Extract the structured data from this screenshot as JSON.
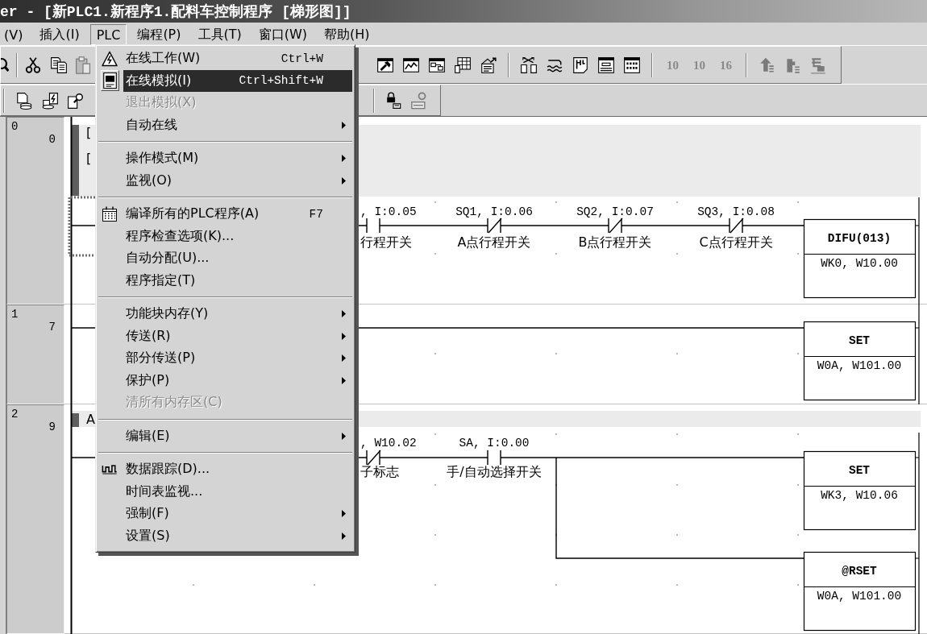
{
  "window": {
    "title": "er - [新PLC1.新程序1.配料车控制程序 [梯形图]]"
  },
  "menu_bar": [
    {
      "label": "(V)",
      "selected": false
    },
    {
      "label": "插入(I)",
      "selected": false
    },
    {
      "label": "PLC",
      "selected": true
    },
    {
      "label": "编程(P)",
      "selected": false
    },
    {
      "label": "工具(T)",
      "selected": false
    },
    {
      "label": "窗口(W)",
      "selected": false
    },
    {
      "label": "帮助(H)",
      "selected": false
    }
  ],
  "toolbars": [
    {
      "segments": [
        [
          {
            "kind": "button",
            "disabled": false
          },
          {
            "kind": "separator"
          },
          {
            "kind": "button",
            "disabled": false
          },
          {
            "kind": "button",
            "disabled": false
          },
          {
            "kind": "button",
            "disabled": true
          }
        ],
        [
          {
            "kind": "button",
            "disabled": false
          },
          {
            "kind": "button",
            "disabled": false
          },
          {
            "kind": "button",
            "disabled": false
          },
          {
            "kind": "button",
            "disabled": false
          },
          {
            "kind": "button",
            "disabled": false
          },
          {
            "kind": "separator"
          },
          {
            "kind": "button",
            "disabled": false
          },
          {
            "kind": "button",
            "disabled": false
          },
          {
            "kind": "button",
            "disabled": false
          },
          {
            "kind": "button",
            "disabled": false
          },
          {
            "kind": "button",
            "disabled": false
          },
          {
            "kind": "separator"
          },
          {
            "kind": "text",
            "label": "10",
            "disabled": true
          },
          {
            "kind": "text",
            "label": "10",
            "disabled": true
          },
          {
            "kind": "text",
            "label": "16",
            "disabled": true
          },
          {
            "kind": "separator"
          },
          {
            "kind": "button",
            "disabled": true
          },
          {
            "kind": "button",
            "disabled": true
          },
          {
            "kind": "button",
            "disabled": true
          }
        ]
      ]
    },
    {
      "segments": [
        [
          {
            "kind": "separator"
          },
          {
            "kind": "button",
            "disabled": false
          },
          {
            "kind": "button",
            "disabled": false
          },
          {
            "kind": "button",
            "disabled": false
          }
        ],
        [
          {
            "kind": "separator"
          },
          {
            "kind": "button",
            "disabled": false
          },
          {
            "kind": "button",
            "disabled": true
          }
        ]
      ]
    }
  ],
  "plc_menu": {
    "groups": [
      [
        {
          "label": "在线工作(W)",
          "shortcut": "Ctrl+W",
          "selected": false,
          "disabled": false,
          "submenu": false
        },
        {
          "label": "在线模拟(I)",
          "shortcut": "Ctrl+Shift+W",
          "selected": true,
          "disabled": false,
          "submenu": false
        },
        {
          "label": "退出模拟(X)",
          "selected": false,
          "disabled": true,
          "submenu": false
        },
        {
          "label": "自动在线",
          "selected": false,
          "disabled": false,
          "submenu": true
        }
      ],
      [
        {
          "label": "操作模式(M)",
          "selected": false,
          "disabled": false,
          "submenu": true
        },
        {
          "label": "监视(O)",
          "selected": false,
          "disabled": false,
          "submenu": true
        }
      ],
      [
        {
          "label": "编译所有的PLC程序(A)",
          "shortcut": "F7",
          "selected": false,
          "disabled": false,
          "submenu": false
        },
        {
          "label": "程序检查选项(K)...",
          "selected": false,
          "disabled": false,
          "submenu": false
        },
        {
          "label": "自动分配(U)...",
          "selected": false,
          "disabled": false,
          "submenu": false
        },
        {
          "label": "程序指定(T)",
          "selected": false,
          "disabled": false,
          "submenu": false
        }
      ],
      [
        {
          "label": "功能块内存(Y)",
          "selected": false,
          "disabled": false,
          "submenu": true
        },
        {
          "label": "传送(R)",
          "selected": false,
          "disabled": false,
          "submenu": true
        },
        {
          "label": "部分传送(P)",
          "selected": false,
          "disabled": false,
          "submenu": true
        },
        {
          "label": "保护(P)",
          "selected": false,
          "disabled": false,
          "submenu": true
        },
        {
          "label": "清所有内存区(C)",
          "selected": false,
          "disabled": true,
          "submenu": false
        }
      ],
      [
        {
          "label": "编辑(E)",
          "selected": false,
          "disabled": false,
          "submenu": true
        }
      ],
      [
        {
          "label": "数据跟踪(D)...",
          "selected": false,
          "disabled": false,
          "submenu": false
        },
        {
          "label": "时间表监视...",
          "selected": false,
          "disabled": false,
          "submenu": false
        },
        {
          "label": "强制(F)",
          "selected": false,
          "disabled": false,
          "submenu": true
        },
        {
          "label": "设置(S)",
          "selected": false,
          "disabled": false,
          "submenu": true
        }
      ]
    ]
  },
  "rungs": [
    {
      "number": "0",
      "step": "0",
      "cursor": true,
      "comment_lines": [
        "[",
        "["
      ],
      "contacts": [
        {
          "kind": "no",
          "operand": ", I:0.05",
          "comment": "行程开关"
        },
        {
          "kind": "nc",
          "operand": "SQ1, I:0.06",
          "comment": "A点行程开关"
        },
        {
          "kind": "nc",
          "operand": "SQ2, I:0.07",
          "comment": "B点行程开关"
        },
        {
          "kind": "nc",
          "operand": "SQ3, I:0.08",
          "comment": "C点行程开关"
        }
      ],
      "outputs": [
        {
          "instruction": "DIFU(013)",
          "operands": "WK0, W10.00"
        }
      ]
    },
    {
      "number": "1",
      "step": "7",
      "cursor": false,
      "outputs": [
        {
          "instruction": "SET",
          "operands": "W0A, W101.00"
        }
      ]
    },
    {
      "number": "2",
      "step": "9",
      "cursor": false,
      "comment_lines": [
        "A"
      ],
      "contacts": [
        {
          "kind": "nc",
          "operand": ", W10.02",
          "comment": "子标志"
        },
        {
          "kind": "no",
          "operand": "SA, I:0.00",
          "comment": "手/自动选择开关"
        }
      ],
      "outputs": [
        {
          "instruction": "SET",
          "operands": "WK3, W10.06"
        },
        {
          "instruction": "@RSET",
          "operands": "W0A, W101.00"
        }
      ]
    }
  ]
}
